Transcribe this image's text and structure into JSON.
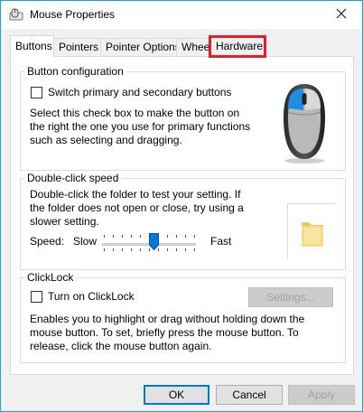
{
  "window": {
    "title": "Mouse Properties"
  },
  "tabs": [
    {
      "label": "Buttons",
      "active": true
    },
    {
      "label": "Pointers"
    },
    {
      "label": "Pointer Options"
    },
    {
      "label": "Wheel"
    },
    {
      "label": "Hardware",
      "highlighted": true
    }
  ],
  "button_config": {
    "legend": "Button configuration",
    "switch_label": "Switch primary and secondary buttons",
    "switch_checked": false,
    "description": "Select this check box to make the button on the right the one you use for primary functions such as selecting and dragging."
  },
  "double_click": {
    "legend": "Double-click speed",
    "description": "Double-click the folder to test your setting. If the folder does not open or close, try using a slower setting.",
    "speed_label": "Speed:",
    "slow_label": "Slow",
    "fast_label": "Fast",
    "speed_fraction": 0.55
  },
  "clicklock": {
    "legend": "ClickLock",
    "turn_on_label": "Turn on ClickLock",
    "checked": false,
    "settings_label": "Settings...",
    "description": "Enables you to highlight or drag without holding down the mouse button. To set, briefly press the mouse button. To release, click the mouse button again."
  },
  "footer": {
    "ok": "OK",
    "cancel": "Cancel",
    "apply": "Apply"
  },
  "colors": {
    "accent": "#0078d7",
    "highlight": "#e0202e",
    "mouse_blue": "#1e8fe0"
  }
}
